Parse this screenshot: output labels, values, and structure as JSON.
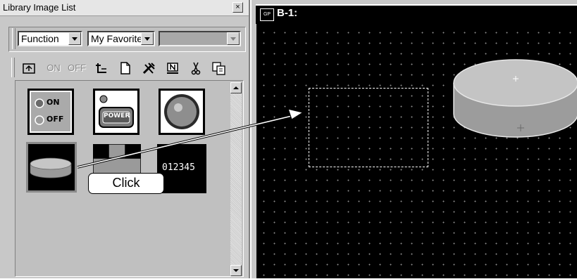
{
  "library_panel": {
    "title": "Library Image List",
    "close_glyph": "×",
    "filter_function": "Function",
    "filter_favorites": "My Favorite",
    "toolbar": {
      "on_label": "ON",
      "off_label": "OFF"
    },
    "thumbnails": [
      {
        "name": "on-off-switch",
        "on_text": "ON",
        "off_text": "OFF"
      },
      {
        "name": "power-button",
        "text": "POWER"
      },
      {
        "name": "round-lamp"
      },
      {
        "name": "cylinder-tank"
      },
      {
        "name": "t-shape-pipe"
      },
      {
        "name": "numeric-display",
        "text": "012345"
      }
    ]
  },
  "canvas_panel": {
    "title": "B-1:",
    "icon_text": "GP"
  },
  "callout": {
    "label": "Click"
  },
  "colors": {
    "canvas_background": "#000000",
    "grid_dots": "#8a8a8a",
    "panel_gray": "#c0c0c0",
    "cylinder_side": "#9a9a9a",
    "cylinder_top": "#c4c4c4"
  }
}
